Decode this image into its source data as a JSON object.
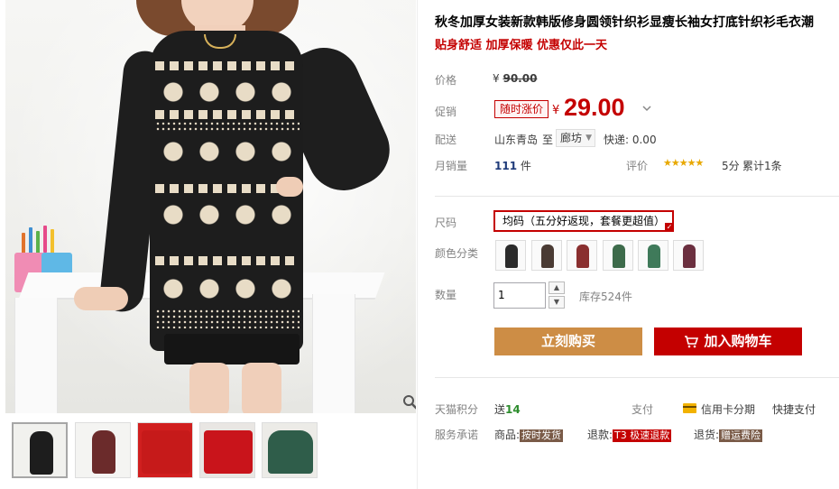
{
  "product": {
    "title": "秋冬加厚女装新款韩版修身圆领针织衫显瘦长袖女打底针织衫毛衣潮",
    "subtitle": "贴身舒适 加厚保暖 优惠仅此一天"
  },
  "price": {
    "label": "价格",
    "currency": "¥",
    "original": "90.00",
    "promo_label": "促销",
    "promo_tag": "随时涨价",
    "current": "29.00",
    "dropdown_icon": "chevron-down-icon"
  },
  "shipping": {
    "label": "配送",
    "from": "山东青岛",
    "to_prefix": "至",
    "to": "廊坊",
    "fee": "快递: 0.00"
  },
  "sales": {
    "label": "月销量",
    "count": "111",
    "unit": "件",
    "rating_label": "评价",
    "stars": "★★★★★",
    "score": "5分",
    "review_count": "累计1条"
  },
  "options": {
    "size_label": "尺码",
    "size_value": "均码（五分好返现，套餐更超值）",
    "color_label": "颜色分类",
    "swatch_colors": [
      "#2b2b2b",
      "#4a3b34",
      "#8a2f2f",
      "#3d6b4b",
      "#3f7a5a",
      "#6b2f3f"
    ]
  },
  "quantity": {
    "label": "数量",
    "value": "1",
    "stock": "库存524件"
  },
  "actions": {
    "buy_now": "立刻购买",
    "add_to_cart": "加入购物车"
  },
  "services": {
    "points_label": "天猫积分",
    "points_prefix": "送",
    "points_value": "14",
    "pay_label": "支付",
    "credit": "信用卡分期",
    "express_pay": "快捷支付",
    "promise_label": "服务承诺",
    "items": [
      {
        "prefix": "商品:",
        "tag": "按时发货"
      },
      {
        "prefix": "退款:",
        "tag": "T3 极速退款"
      },
      {
        "prefix": "退货:",
        "tag": "赠运费险"
      }
    ]
  },
  "gallery": {
    "thumb_colors": [
      "#1d1d1d",
      "#6b2b2b",
      "#c61a1a",
      "#c9141b",
      "#2f5d4a"
    ]
  },
  "colors": {
    "accent_red": "#c40000",
    "buy_orange": "#cd8d45",
    "star_gold": "#e8a800"
  }
}
